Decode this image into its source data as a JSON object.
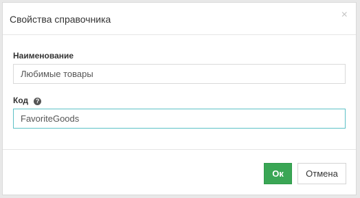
{
  "dialog": {
    "title": "Свойства справочника",
    "close_glyph": "×"
  },
  "fields": {
    "name": {
      "label": "Наименование",
      "value": "Любимые товары"
    },
    "code": {
      "label": "Код",
      "help_glyph": "?",
      "value": "FavoriteGoods"
    }
  },
  "footer": {
    "ok_label": "Ок",
    "cancel_label": "Отмена"
  },
  "colors": {
    "ok_button": "#3aa655",
    "focus_border": "#5bc0c6"
  }
}
